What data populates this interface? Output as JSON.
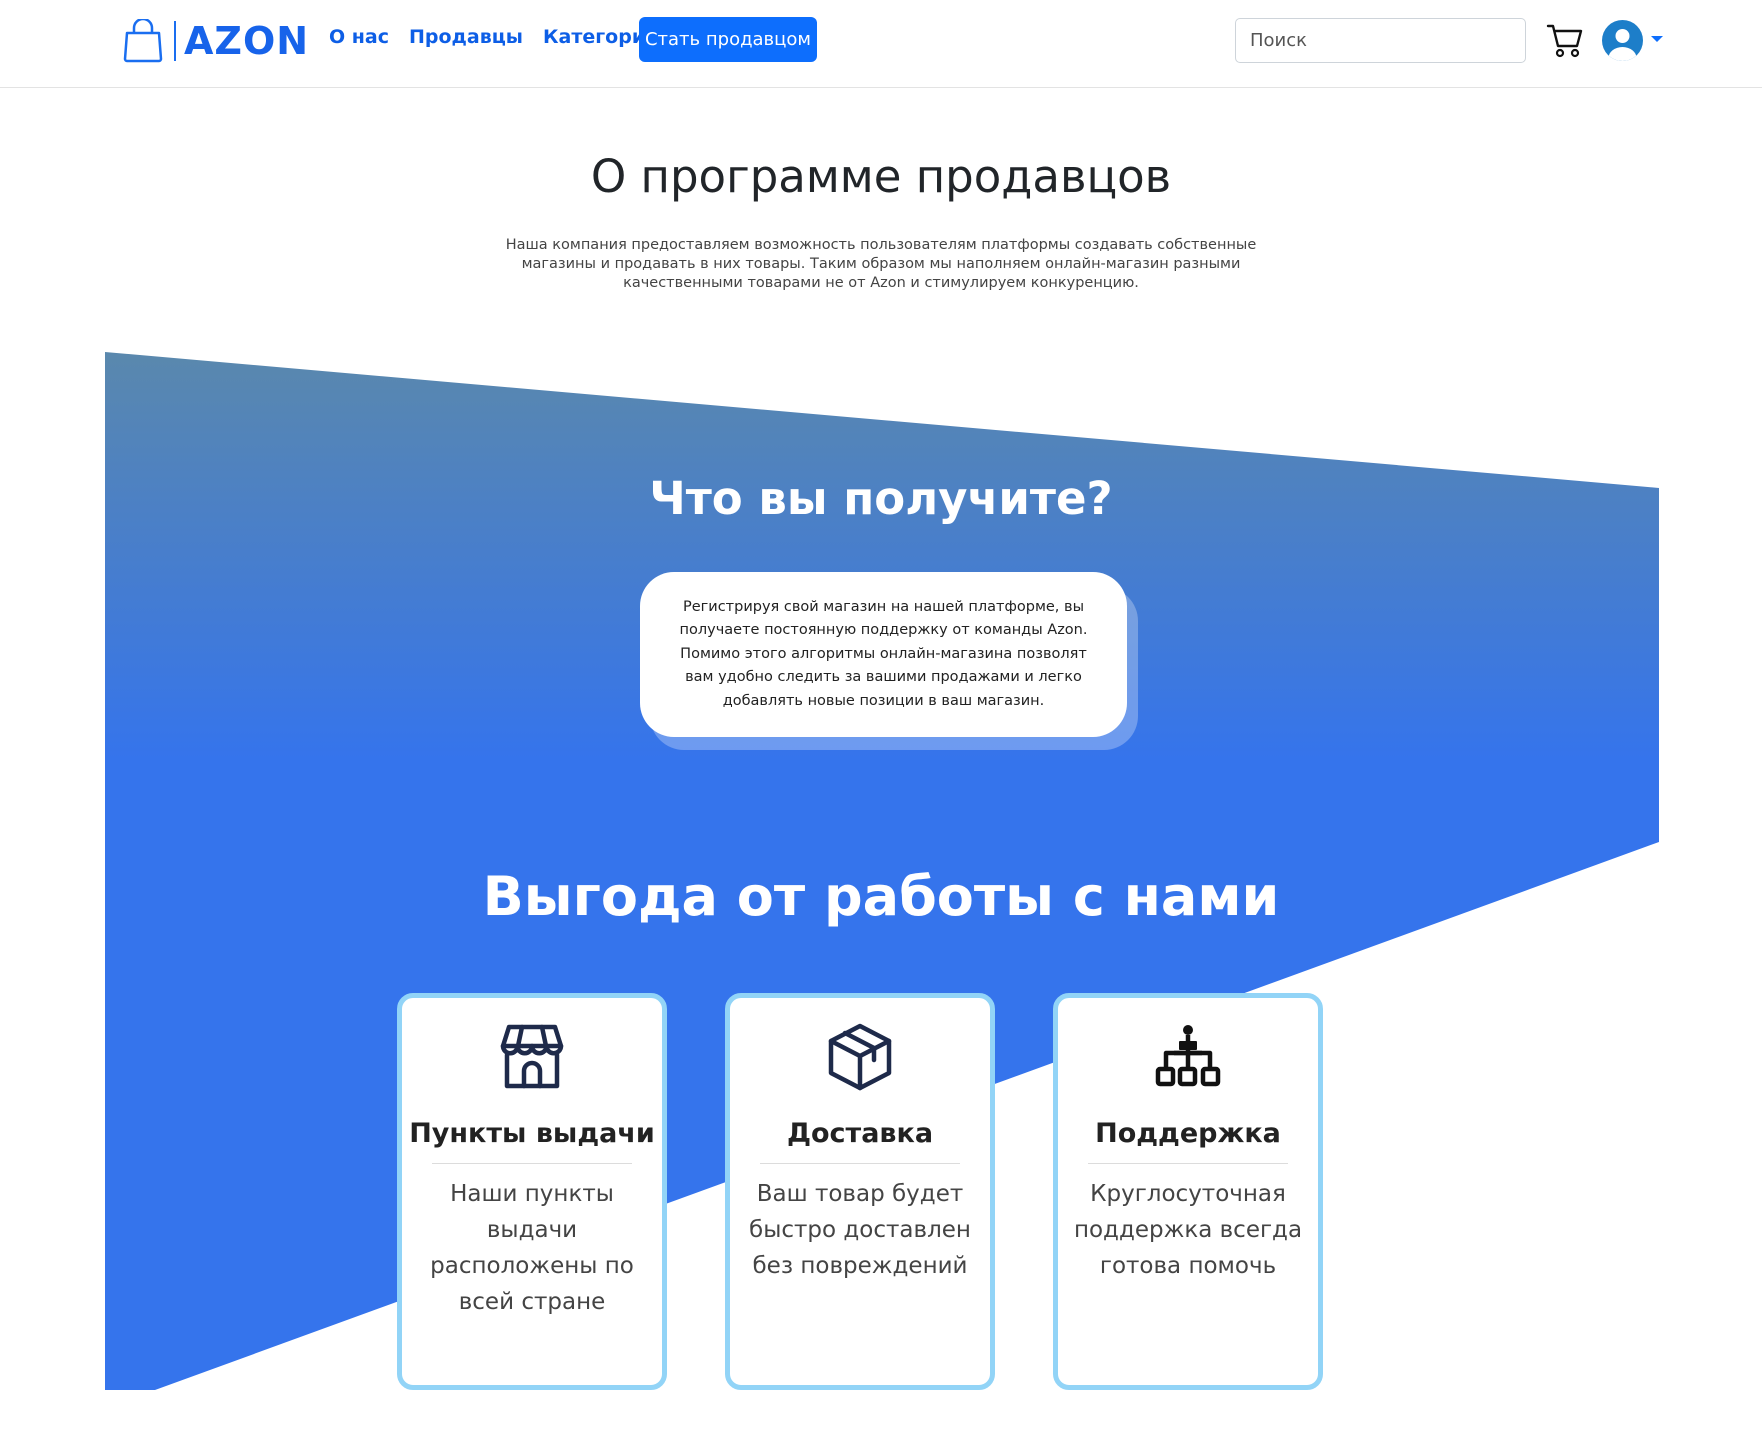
{
  "header": {
    "logo_text": "AZON",
    "nav": [
      "О нас",
      "Продавцы",
      "Категории"
    ],
    "cta_label": "Стать продавцом",
    "search_placeholder": "Поиск",
    "icons": [
      "bag-logo-icon",
      "cart-icon",
      "user-avatar-icon",
      "caret-down-icon"
    ]
  },
  "intro": {
    "title": "О программе продавцов",
    "text": "Наша компания предоставляем возможность пользователям платформы создавать собственные магазины и продавать в них товары. Таким образом мы наполняем онлайн-магазин разными качественными товарами не от Azon и стимулируем конкуренцию."
  },
  "benefits": {
    "title": "Что вы получите?",
    "text": "Регистрируя свой магазин на нашей платформе, вы получаете постоянную поддержку от команды Azon. Помимо этого алгоритмы онлайн-магазина позволят вам удобно следить за вашими продажами и легко добавлять новые позиции в ваш магазин."
  },
  "advantages": {
    "title": "Выгода от работы с нами",
    "cards": [
      {
        "icon": "store-icon",
        "title": "Пункты выдачи",
        "text": "Наши пункты выдачи расположены по всей стране"
      },
      {
        "icon": "package-icon",
        "title": "Доставка",
        "text": "Ваш товар будет быстро доставлен без повреждений"
      },
      {
        "icon": "hierarchy-icon",
        "title": "Поддержка",
        "text": "Круглосуточная поддержка всегда готова помочь"
      }
    ]
  },
  "colors": {
    "brand": "#1763ea",
    "primary_button": "#0d6efd",
    "gradient_top": "#5a88ad",
    "gradient_bottom": "#3574ec",
    "card_border": "#92d4f7"
  }
}
